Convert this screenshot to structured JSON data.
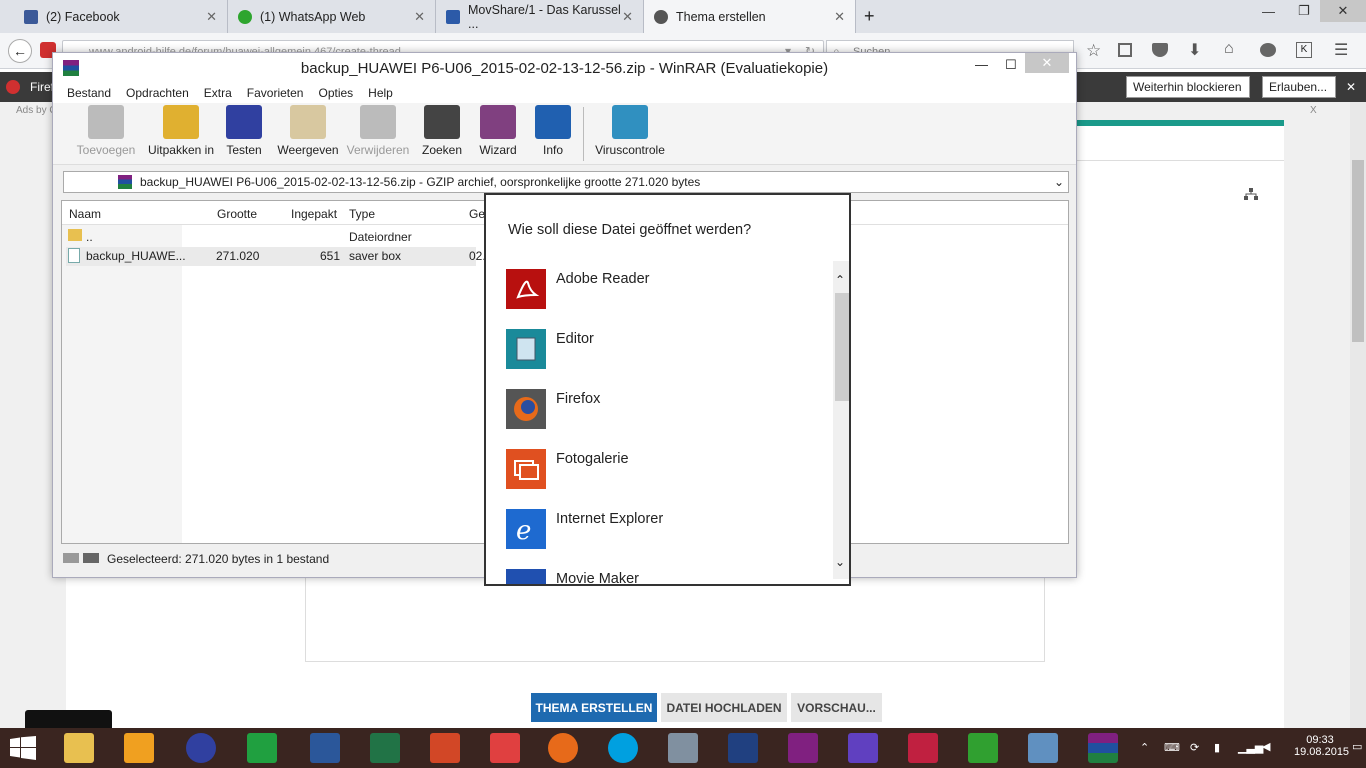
{
  "browser": {
    "tabs": [
      {
        "label": "(2) Facebook",
        "color": "#3b5998"
      },
      {
        "label": "(1) WhatsApp Web",
        "color": "#2ea52e"
      },
      {
        "label": "MovShare/1 - Das Karussel ...",
        "color": "#2c5aa8"
      },
      {
        "label": "Thema erstellen",
        "color": "#555555"
      }
    ],
    "new_tab": "+",
    "url": "www.android-hilfe.de/forum/huawei-allgemein.467/create-thread",
    "search_placeholder": "Suchen",
    "notif_left": "Firef",
    "notif_btn_block": "Weiterhin blockieren",
    "notif_btn_allow": "Erlauben...",
    "ads_label": "Ads by C",
    "ads_close": "X"
  },
  "page": {
    "btn_create": "THEMA ERSTELLEN",
    "btn_upload": "DATEI HOCHLADEN",
    "btn_preview": "VORSCHAU..."
  },
  "winrar": {
    "title": "backup_HUAWEI P6-U06_2015-02-02-13-12-56.zip - WinRAR (Evaluatiekopie)",
    "menu": [
      "Bestand",
      "Opdrachten",
      "Extra",
      "Favorieten",
      "Opties",
      "Help"
    ],
    "toolbar": [
      {
        "label": "Toevoegen",
        "disabled": true
      },
      {
        "label": "Uitpakken in",
        "disabled": false
      },
      {
        "label": "Testen",
        "disabled": false
      },
      {
        "label": "Weergeven",
        "disabled": false
      },
      {
        "label": "Verwijderen",
        "disabled": true
      },
      {
        "label": "Zoeken",
        "disabled": false
      },
      {
        "label": "Wizard",
        "disabled": false
      },
      {
        "label": "Info",
        "disabled": false
      },
      {
        "label": "Viruscontrole",
        "disabled": false
      }
    ],
    "path": "backup_HUAWEI P6-U06_2015-02-02-13-12-56.zip - GZIP archief, oorspronkelijke grootte 271.020 bytes",
    "columns": [
      "Naam",
      "Grootte",
      "Ingepakt",
      "Type",
      "Ge"
    ],
    "rows": [
      {
        "name": "..",
        "size": "",
        "packed": "",
        "type": "Dateiordner",
        "date": ""
      },
      {
        "name": "backup_HUAWE...",
        "size": "271.020",
        "packed": "651",
        "type": "saver box",
        "date": "02."
      }
    ],
    "status": "Geselecteerd: 271.020 bytes in 1 bestand"
  },
  "dialog": {
    "title": "Wie soll diese Datei geöffnet werden?",
    "apps": [
      {
        "name": "Adobe Reader",
        "icon": "adobe-reader-icon",
        "color": "#b8100f"
      },
      {
        "name": "Editor",
        "icon": "editor-icon",
        "color": "#1a8a9a"
      },
      {
        "name": "Firefox",
        "icon": "firefox-icon",
        "color": "#555555"
      },
      {
        "name": "Fotogalerie",
        "icon": "photo-gallery-icon",
        "color": "#e05020"
      },
      {
        "name": "Internet Explorer",
        "icon": "internet-explorer-icon",
        "color": "#1e6ad0"
      },
      {
        "name": "Movie Maker",
        "icon": "movie-maker-icon",
        "color": "#2050b0"
      }
    ]
  },
  "taskbar": {
    "time": "09:33",
    "date": "19.08.2015"
  }
}
